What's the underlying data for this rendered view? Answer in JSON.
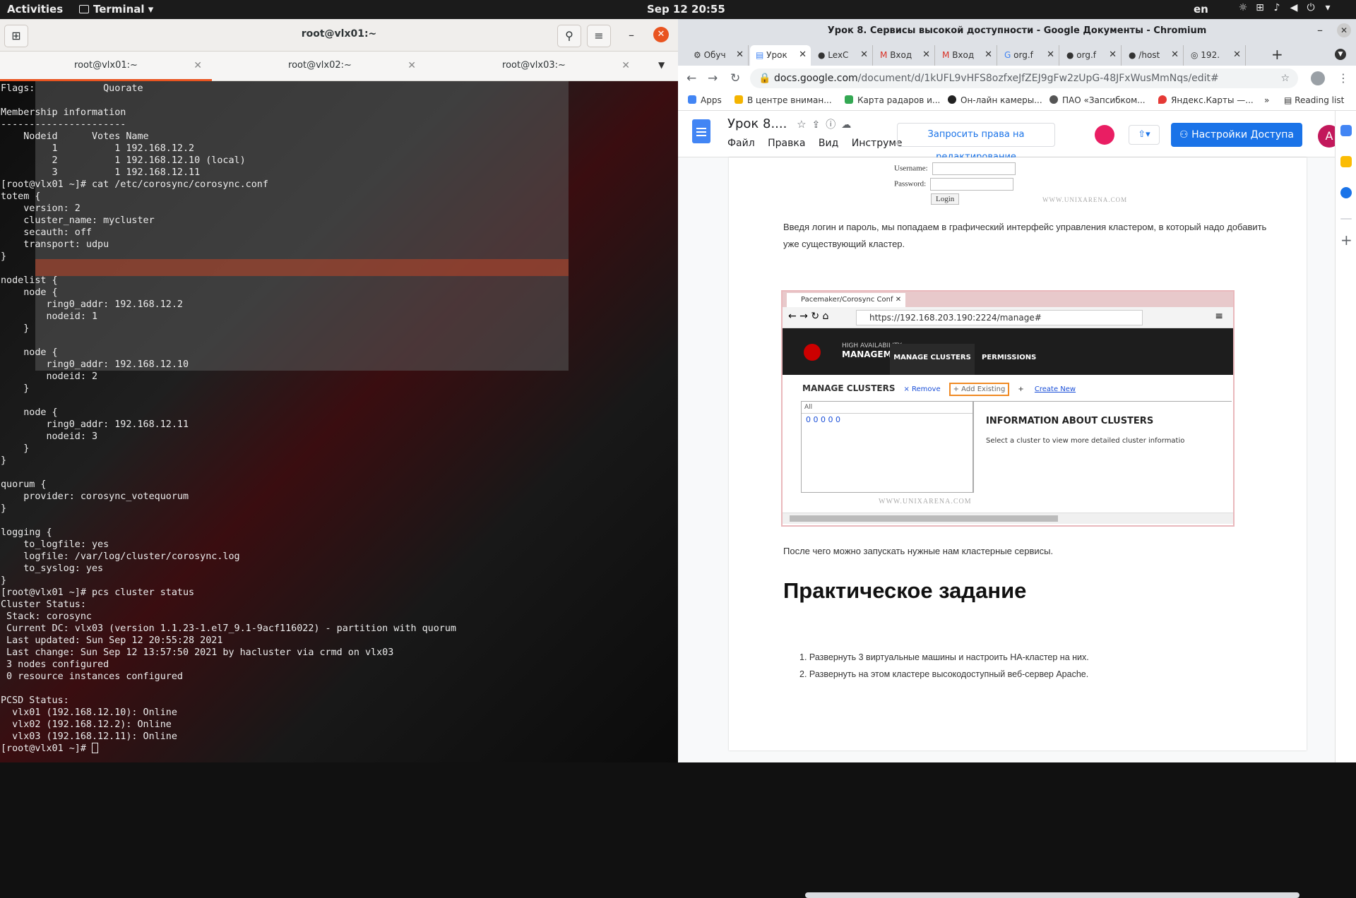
{
  "topbar": {
    "activities": "Activities",
    "app_name": "Terminal",
    "clock": "Sep 12  20:55",
    "lang": "en"
  },
  "terminal": {
    "title": "root@vlx01:~",
    "tabs": [
      "root@vlx01:~",
      "root@vlx02:~",
      "root@vlx03:~"
    ],
    "output": "Flags:            Quorate\n\nMembership information\n----------------------\n    Nodeid      Votes Name\n         1          1 192.168.12.2\n         2          1 192.168.12.10 (local)\n         3          1 192.168.12.11\n[root@vlx01 ~]# cat /etc/corosync/corosync.conf\ntotem {\n    version: 2\n    cluster_name: mycluster\n    secauth: off\n    transport: udpu\n}\n\nnodelist {\n    node {\n        ring0_addr: 192.168.12.2\n        nodeid: 1\n    }\n\n    node {\n        ring0_addr: 192.168.12.10\n        nodeid: 2\n    }\n\n    node {\n        ring0_addr: 192.168.12.11\n        nodeid: 3\n    }\n}\n\nquorum {\n    provider: corosync_votequorum\n}\n\nlogging {\n    to_logfile: yes\n    logfile: /var/log/cluster/corosync.log\n    to_syslog: yes\n}\n[root@vlx01 ~]# pcs cluster status\nCluster Status:\n Stack: corosync\n Current DC: vlx03 (version 1.1.23-1.el7_9.1-9acf116022) - partition with quorum\n Last updated: Sun Sep 12 20:55:28 2021\n Last change: Sun Sep 12 13:57:50 2021 by hacluster via crmd on vlx03\n 3 nodes configured\n 0 resource instances configured\n\nPCSD Status:\n  vlx01 (192.168.12.10): Online\n  vlx02 (192.168.12.2): Online\n  vlx03 (192.168.12.11): Online",
    "prompt": "[root@vlx01 ~]# "
  },
  "browser": {
    "window_title": "Урок 8. Сервисы высокой доступности - Google Документы - Chromium",
    "tabs": [
      "Обуч",
      "Урок",
      "LexC",
      "Вход",
      "Вход",
      "org.f",
      "org.f",
      "/host",
      "192."
    ],
    "url_domain": "docs.google.com",
    "url_path": "/document/d/1kUFL9vHFS8ozfxeJfZEJ9gFw2zUpG-48JFxWusMmNqs/edit#",
    "bookmarks": [
      "Apps",
      "В центре вниман...",
      "Карта радаров и...",
      "Он-лайн камеры...",
      "ПАО «Запсибком...",
      "Яндекс.Карты —...",
      "»",
      "Reading list"
    ]
  },
  "doc": {
    "title": "Урок 8....",
    "menu": [
      "Файл",
      "Правка",
      "Вид",
      "Инструме"
    ],
    "request_edit": "Запросить права на редактирование",
    "share": "Настройки Доступа",
    "avatar": "A",
    "login_username": "Username:",
    "login_password": "Password:",
    "login_button": "Login",
    "watermark": "WWW.UNIXARENA.COM",
    "para1": "Введя логин и пароль, мы попадаем в графический интерфейс управления кластером, в который надо добавить уже существующий кластер.",
    "shot": {
      "tab": "Pacemaker/Corosync Conf",
      "url": "https://192.168.203.190:2224/manage#",
      "ha_small": "HIGH AVAILABILITY",
      "ha_big": "MANAGEMENT",
      "nav1": "MANAGE CLUSTERS",
      "nav2": "PERMISSIONS",
      "manage": "MANAGE CLUSTERS",
      "remove": "× Remove",
      "add_existing": "+ Add Existing",
      "create_new": "Create New",
      "list_header": "All",
      "list_values": "0          0          0          0          0",
      "info_title": "INFORMATION ABOUT CLUSTERS",
      "info_sub": "Select a cluster to view more detailed cluster informatio",
      "watermark": "WWW.UNIXARENA.COM"
    },
    "para2": "После чего можно запускать нужные нам кластерные сервисы.",
    "heading": "Практическое задание",
    "tasks": [
      "1.    Развернуть 3 виртуальные машины и настроить HA-кластер на них.",
      "2.    Развернуть на этом кластере высокодоступный веб-сервер Apache."
    ]
  }
}
